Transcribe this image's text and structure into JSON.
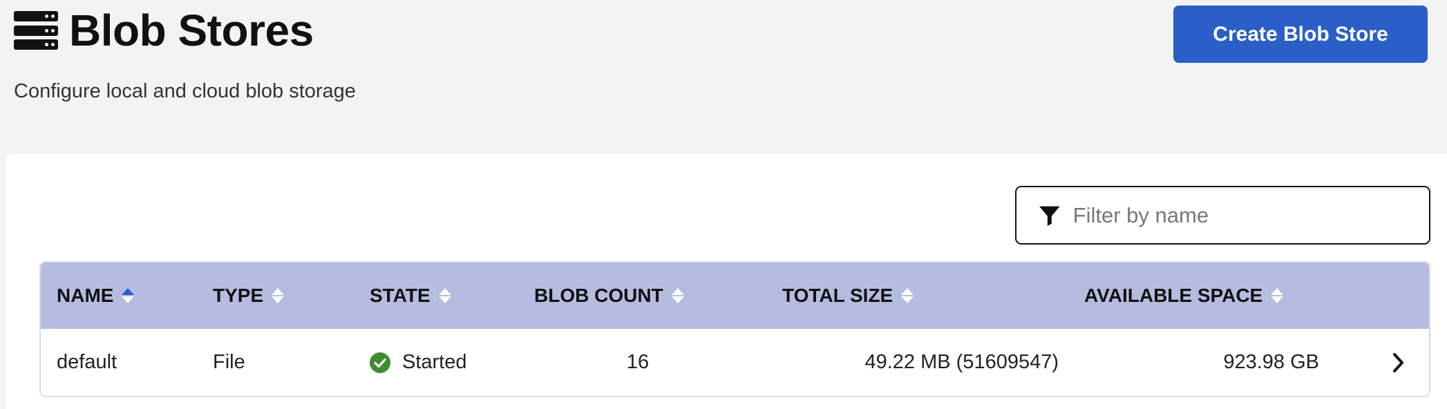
{
  "header": {
    "title": "Blob Stores",
    "icon": "server-stack-icon",
    "subtitle": "Configure local and cloud blob storage",
    "create_button": "Create Blob Store"
  },
  "filter": {
    "icon": "filter-icon",
    "placeholder": "Filter by name",
    "value": ""
  },
  "table": {
    "columns": [
      {
        "key": "name",
        "label": "NAME",
        "sort": "ascending"
      },
      {
        "key": "type",
        "label": "TYPE",
        "sort": "none"
      },
      {
        "key": "state",
        "label": "STATE",
        "sort": "none"
      },
      {
        "key": "blob_count",
        "label": "BLOB COUNT",
        "sort": "none"
      },
      {
        "key": "total_size",
        "label": "TOTAL SIZE",
        "sort": "none"
      },
      {
        "key": "available_space",
        "label": "AVAILABLE SPACE",
        "sort": "none"
      }
    ],
    "rows": [
      {
        "name": "default",
        "type": "File",
        "state": "Started",
        "state_icon": "check-circle-icon",
        "blob_count": "16",
        "total_size": "49.22 MB (51609547)",
        "available_space": "923.98 GB"
      }
    ]
  },
  "colors": {
    "accent": "#2a5fc7",
    "header_row": "#b5bce0",
    "success": "#3f8d2f",
    "background": "#f3f3f3"
  }
}
